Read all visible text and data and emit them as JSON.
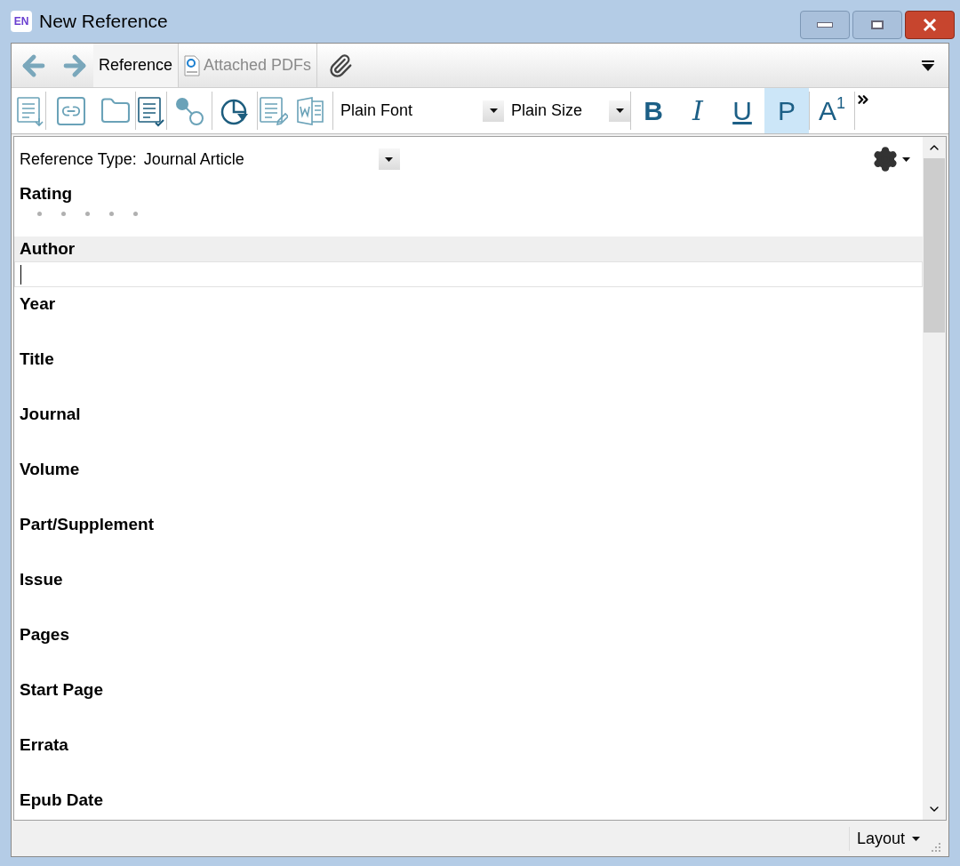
{
  "window": {
    "title": "New Reference",
    "app_badge": "EN"
  },
  "tabs": [
    {
      "label": "Reference",
      "selected": true,
      "kind": "text"
    },
    {
      "label": "Attached PDFs",
      "selected": false,
      "kind": "pdf"
    }
  ],
  "toolbar": {
    "font": "Plain Font",
    "size": "Plain Size",
    "format_buttons": [
      {
        "label": "B",
        "selected": false,
        "kind": "bold"
      },
      {
        "label": "I",
        "selected": false,
        "kind": "italic"
      },
      {
        "label": "U",
        "selected": false,
        "kind": "underline"
      },
      {
        "label": "P",
        "selected": true,
        "kind": "plain"
      },
      {
        "label": "A",
        "superscript": "1",
        "selected": false,
        "kind": "super"
      }
    ]
  },
  "reference_type": {
    "label": "Reference Type:",
    "value": "Journal Article"
  },
  "fields": [
    {
      "label": "Rating",
      "kind": "rating",
      "stars": 0
    },
    {
      "label": "Author",
      "kind": "text",
      "focused": true
    },
    {
      "label": "Year",
      "kind": "text",
      "focused": false
    },
    {
      "label": "Title",
      "kind": "text",
      "focused": false
    },
    {
      "label": "Journal",
      "kind": "text",
      "focused": false
    },
    {
      "label": "Volume",
      "kind": "text",
      "focused": false
    },
    {
      "label": "Part/Supplement",
      "kind": "text",
      "focused": false
    },
    {
      "label": "Issue",
      "kind": "text",
      "focused": false
    },
    {
      "label": "Pages",
      "kind": "text",
      "focused": false
    },
    {
      "label": "Start Page",
      "kind": "text",
      "focused": false
    },
    {
      "label": "Errata",
      "kind": "text",
      "focused": false
    },
    {
      "label": "Epub Date",
      "kind": "text",
      "focused": false
    }
  ],
  "status_bar": {
    "layout": "Layout"
  }
}
